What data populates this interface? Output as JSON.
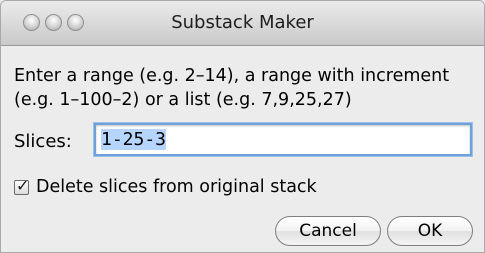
{
  "window": {
    "title": "Substack Maker"
  },
  "instructions": {
    "line1": "Enter a range (e.g. 2–14), a range with increment",
    "line2": "(e.g. 1–100–2) or a list (e.g. 7,9,25,27)"
  },
  "slices": {
    "label": "Slices:",
    "value": "1-25-3"
  },
  "delete_option": {
    "label": "Delete slices from original stack",
    "checked": true
  },
  "buttons": {
    "cancel": "Cancel",
    "ok": "OK"
  },
  "icons": {
    "close": "close-icon",
    "minimize": "minimize-icon",
    "zoom": "zoom-icon",
    "check": "check-icon"
  }
}
